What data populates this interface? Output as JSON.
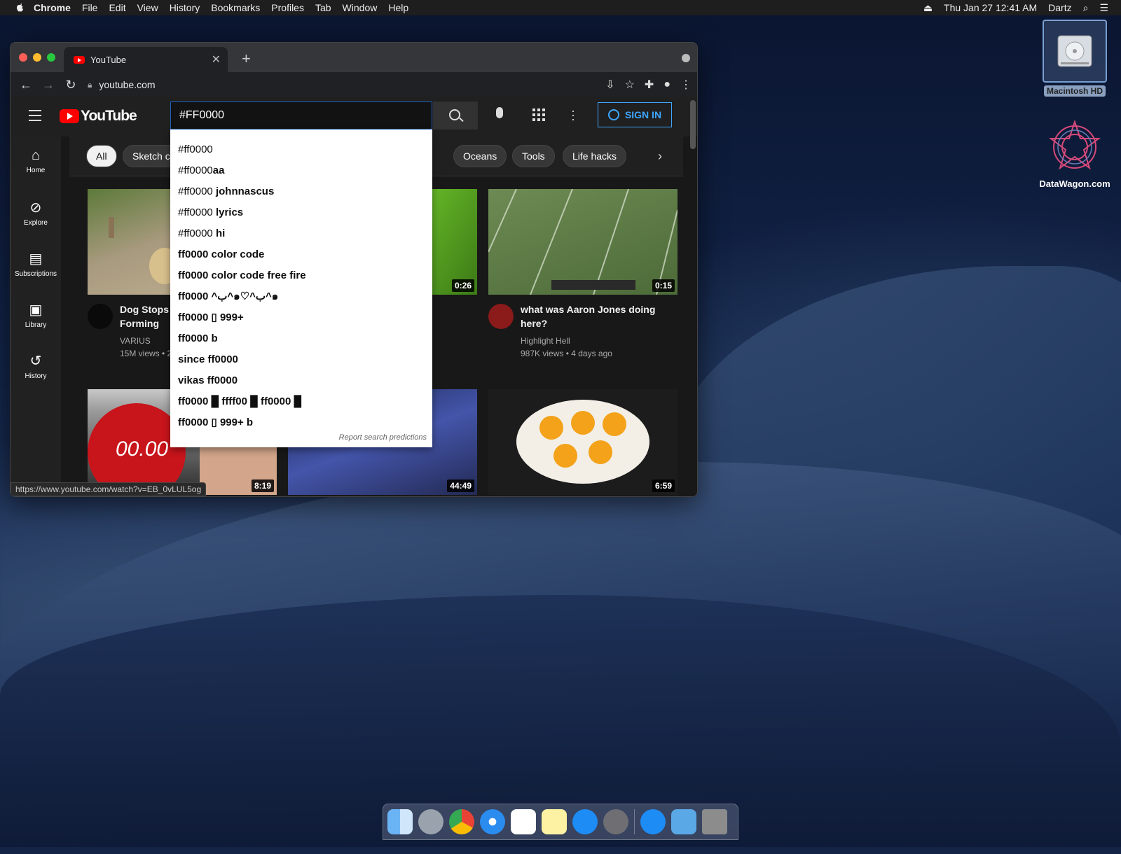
{
  "menubar": {
    "items": [
      "Chrome",
      "File",
      "Edit",
      "View",
      "History",
      "Bookmarks",
      "Profiles",
      "Tab",
      "Window",
      "Help"
    ],
    "datetime": "Thu Jan 27  12:41 AM",
    "user": "Dartz"
  },
  "desktop": {
    "hd_label": "Macintosh HD",
    "datawagon_label": "DataWagon.com"
  },
  "browser": {
    "tab_title": "YouTube",
    "url": "youtube.com",
    "status_url": "https://www.youtube.com/watch?v=EB_0vLUL5og"
  },
  "youtube": {
    "logo_text": "YouTube",
    "search_value": "#FF0000",
    "signin_label": "SIGN IN",
    "sidebar": [
      {
        "label": "Home",
        "icon": "home-icon"
      },
      {
        "label": "Explore",
        "icon": "compass-icon"
      },
      {
        "label": "Subscriptions",
        "icon": "subscriptions-icon"
      },
      {
        "label": "Library",
        "icon": "library-icon"
      },
      {
        "label": "History",
        "icon": "history-icon"
      }
    ],
    "chips": [
      "All",
      "Sketch co",
      "Oceans",
      "Tools",
      "Life hacks"
    ],
    "suggestions": [
      {
        "pfx": "#ff0000",
        "rest": ""
      },
      {
        "pfx": "#ff0000",
        "rest": "aa"
      },
      {
        "pfx": "#ff0000",
        "rest": " johnnascus"
      },
      {
        "pfx": "#ff0000",
        "rest": " lyrics"
      },
      {
        "pfx": "#ff0000",
        "rest": " hi"
      },
      {
        "pfx": "",
        "rest": "ff0000 color code"
      },
      {
        "pfx": "",
        "rest": "ff0000 color code free fire"
      },
      {
        "pfx": "",
        "rest": "ff0000 ^ب^๑♡^ب^๑"
      },
      {
        "pfx": "",
        "rest": "ff0000 ▯ 999+"
      },
      {
        "pfx": "",
        "rest": "ff0000 b"
      },
      {
        "pfx": "",
        "rest": "since ff0000"
      },
      {
        "pfx": "",
        "rest": "vikas ff0000"
      },
      {
        "pfx": "",
        "rest": "ff0000 █ ffff00 █ ff0000 █"
      },
      {
        "pfx": "",
        "rest": "ff0000 ▯ 999+ b"
      }
    ],
    "report_label": "Report search predictions",
    "videos": [
      {
        "title_line1": "Dog Stops Tor",
        "title_line2": "Forming",
        "channel": "VARIUS",
        "meta": "15M views • 2 y"
      },
      {
        "duration": "0:26"
      },
      {
        "title_line1": "what was Aaron Jones doing",
        "title_line2": "here?",
        "channel": "Highlight Hell",
        "meta": "987K views • 4 days ago",
        "duration": "0:15"
      },
      {
        "duration": "8:19",
        "overlay": "00.00"
      },
      {
        "duration": "44:49"
      },
      {
        "duration": "6:59"
      }
    ]
  },
  "colors": {
    "yt_red": "#ff0000",
    "signin_blue": "#3ea6ff",
    "search_border": "#1c62b9"
  }
}
